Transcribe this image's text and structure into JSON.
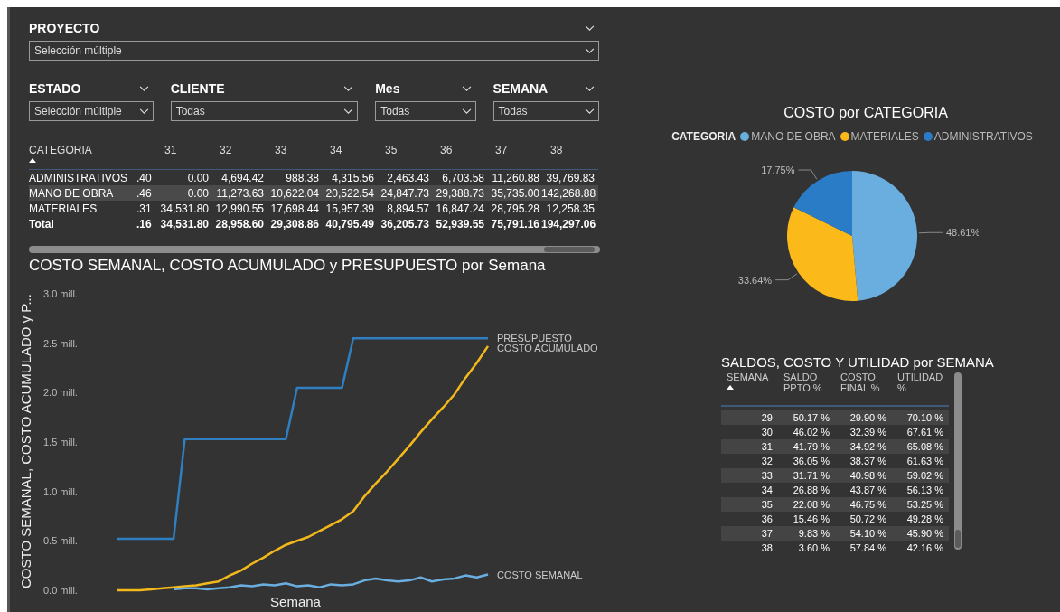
{
  "filters": {
    "proyecto": {
      "title": "PROYECTO",
      "value": "Selección múltiple"
    },
    "row": [
      {
        "title": "ESTADO",
        "value": "Selección múltiple"
      },
      {
        "title": "CLIENTE",
        "value": "Todas"
      },
      {
        "title": "Mes",
        "value": "Todas"
      },
      {
        "title": "SEMANA",
        "value": "Todas"
      }
    ]
  },
  "matrix": {
    "columns": [
      "CATEGORIA",
      "",
      "31",
      "32",
      "33",
      "34",
      "35",
      "36",
      "37",
      "38"
    ],
    "rows": [
      {
        "kind": "data",
        "highlighted": false,
        "cells": [
          "ADMINISTRATIVOS",
          ".40",
          "0.00",
          "4,694.42",
          "988.38",
          "4,315.56",
          "2,463.43",
          "6,703.58",
          "11,260.88",
          "39,769.83"
        ]
      },
      {
        "kind": "data",
        "highlighted": true,
        "cells": [
          "MANO DE OBRA",
          ".46",
          "0.00",
          "11,273.63",
          "10,622.04",
          "20,522.54",
          "24,847.73",
          "29,388.73",
          "35,735.00",
          "142,268.88"
        ]
      },
      {
        "kind": "data",
        "highlighted": false,
        "cells": [
          "MATERIALES",
          ".31",
          "34,531.80",
          "12,990.55",
          "17,698.44",
          "15,957.39",
          "8,894.57",
          "16,847.24",
          "28,795.28",
          "12,258.35"
        ]
      },
      {
        "kind": "total",
        "highlighted": false,
        "cells": [
          "Total",
          ".16",
          "34,531.80",
          "28,958.60",
          "29,308.86",
          "40,795.49",
          "36,205.73",
          "52,939.55",
          "75,791.16",
          "194,297.06"
        ]
      }
    ]
  },
  "line_chart": {
    "chart_data": {
      "type": "line",
      "title": "COSTO SEMANAL, COSTO ACUMULADO y PRESUPUESTO por Semana",
      "xlabel": "Semana",
      "ylabel": "COSTO SEMANAL, COSTO ACUMULADO y P...",
      "ylim": [
        0,
        3
      ],
      "yticks": [
        {
          "value": 0,
          "label": "0.0 mill."
        },
        {
          "value": 0.5,
          "label": "0.5 mill."
        },
        {
          "value": 1,
          "label": "1.0 mill."
        },
        {
          "value": 1.5,
          "label": "1.5 mill."
        },
        {
          "value": 2,
          "label": "2.0 mill."
        },
        {
          "value": 2.5,
          "label": "2.5 mill."
        },
        {
          "value": 3,
          "label": "3.0 mill."
        }
      ],
      "series": [
        {
          "name": "PRESUPUESTO",
          "color": "#2f7fc1",
          "values": [
            0.52,
            0.52,
            0.52,
            0.52,
            0.52,
            0.52,
            1.53,
            1.53,
            1.53,
            1.53,
            1.53,
            1.53,
            1.53,
            1.53,
            1.53,
            1.53,
            2.05,
            2.05,
            2.05,
            2.05,
            2.05,
            2.55,
            2.55,
            2.55,
            2.55,
            2.55,
            2.55,
            2.55,
            2.55,
            2.55,
            2.55,
            2.55,
            2.55,
            2.55
          ]
        },
        {
          "name": "COSTO ACUMULADO",
          "color": "#f2b81c",
          "values": [
            0,
            0,
            0,
            0.01,
            0.02,
            0.03,
            0.04,
            0.05,
            0.07,
            0.09,
            0.15,
            0.2,
            0.27,
            0.33,
            0.4,
            0.46,
            0.5,
            0.54,
            0.6,
            0.66,
            0.72,
            0.8,
            0.95,
            1.08,
            1.2,
            1.33,
            1.46,
            1.6,
            1.73,
            1.85,
            1.98,
            2.15,
            2.3,
            2.47
          ]
        },
        {
          "name": "COSTO SEMANAL",
          "color": "#6aaee0",
          "values": [
            null,
            null,
            null,
            null,
            null,
            0.01,
            0.02,
            0.02,
            0.01,
            0.02,
            0.03,
            0.05,
            0.04,
            0.06,
            0.05,
            0.07,
            0.04,
            0.05,
            0.03,
            0.06,
            0.05,
            0.06,
            0.1,
            0.12,
            0.1,
            0.09,
            0.1,
            0.13,
            0.09,
            0.11,
            0.12,
            0.15,
            0.13,
            0.16
          ]
        }
      ]
    }
  },
  "pie_chart": {
    "chart_data": {
      "type": "pie",
      "title": "COSTO por CATEGORIA",
      "legend": {
        "title": "CATEGORIA"
      },
      "categories": [
        "MANO DE OBRA",
        "MATERIALES",
        "ADMINISTRATIVOS"
      ],
      "values": [
        48.61,
        33.64,
        17.75
      ],
      "colors": [
        "#6aaee0",
        "#fbb91a",
        "#2a7cc7"
      ],
      "value_labels": [
        "48.61%",
        "33.64%",
        "17.75%"
      ]
    }
  },
  "weekly_table": {
    "title": "SALDOS, COSTO Y UTILIDAD por SEMANA",
    "columns": [
      "SEMANA",
      "SALDO PPTO %",
      "COSTO FINAL %",
      "UTILIDAD %"
    ],
    "rows": [
      [
        "29",
        "50.17 %",
        "29.90 %",
        "70.10 %"
      ],
      [
        "30",
        "46.02 %",
        "32.39 %",
        "67.61 %"
      ],
      [
        "31",
        "41.79 %",
        "34.92 %",
        "65.08 %"
      ],
      [
        "32",
        "36.05 %",
        "38.37 %",
        "61.63 %"
      ],
      [
        "33",
        "31.71 %",
        "40.98 %",
        "59.02 %"
      ],
      [
        "34",
        "26.88 %",
        "43.87 %",
        "56.13 %"
      ],
      [
        "35",
        "22.08 %",
        "46.75 %",
        "53.25 %"
      ],
      [
        "36",
        "15.46 %",
        "50.72 %",
        "49.28 %"
      ],
      [
        "37",
        "9.83 %",
        "54.10 %",
        "45.90 %"
      ],
      [
        "38",
        "3.60 %",
        "57.84 %",
        "42.16 %"
      ]
    ]
  }
}
